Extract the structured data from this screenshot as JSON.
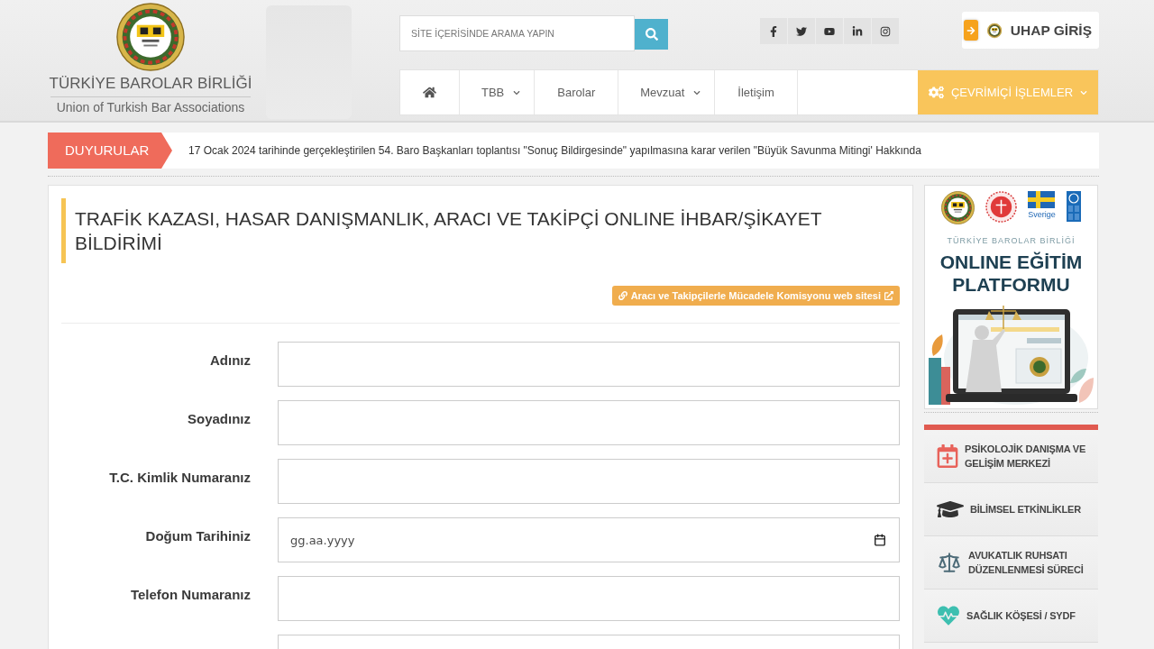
{
  "header": {
    "logo": {
      "title": "TÜRKİYE BAROLAR BİRLİĞİ",
      "subtitle": "Union of Turkish Bar Associations"
    },
    "search": {
      "placeholder": "SİTE İÇERİSİNDE ARAMA YAPIN"
    },
    "social": [
      {
        "kind": "facebook"
      },
      {
        "kind": "twitter"
      },
      {
        "kind": "youtube"
      },
      {
        "kind": "linkedin"
      },
      {
        "kind": "instagram"
      }
    ],
    "login_button": {
      "label": "UHAP GİRİŞ"
    }
  },
  "nav": {
    "items": [
      {
        "kind": "home"
      },
      {
        "kind": "link",
        "label": "TBB",
        "dropdown": true
      },
      {
        "kind": "link",
        "label": "Barolar",
        "dropdown": false
      },
      {
        "kind": "link",
        "label": "Mevzuat",
        "dropdown": true
      },
      {
        "kind": "link",
        "label": "İletişim",
        "dropdown": false
      }
    ],
    "online_button": {
      "label": "ÇEVRİMİÇİ İŞLEMLER",
      "dropdown": true
    }
  },
  "announcements": {
    "label": "DUYURULAR",
    "text": "17 Ocak 2024 tarihinde gerçekleştirilen 54. Baro Başkanları toplantısı \"Sonuç Bildirgesinde\" yapılmasına karar verilen \"Büyük Savunma Mitingi' Hakkında"
  },
  "form": {
    "title": "TRAFİK KAZASI, HASAR DANIŞMANLIK, ARACI VE TAKİPÇİ ONLINE İHBAR/ŞİKAYET BİLDİRİMİ",
    "link_button": {
      "label": "Aracı ve Takipçilerle Mücadele Komisyonu web sitesi"
    },
    "fields": [
      {
        "kind": "text",
        "label": "Adınız"
      },
      {
        "kind": "text",
        "label": "Soyadınız"
      },
      {
        "kind": "text",
        "label": "T.C. Kimlik Numaranız"
      },
      {
        "kind": "date",
        "label": "Doğum Tarihiniz",
        "placeholder": "gg.aa.yyyy"
      },
      {
        "kind": "text",
        "label": "Telefon Numaranız"
      },
      {
        "kind": "text"
      }
    ]
  },
  "sidebar": {
    "banner": {
      "logos": [
        {
          "kind": "tbb"
        },
        {
          "kind": "judiciary"
        },
        {
          "kind": "sweden",
          "caption": "Sverige"
        },
        {
          "kind": "undp"
        }
      ],
      "top_label": "TÜRKİYE BAROLAR BİRLİĞİ",
      "title": "ONLINE EĞİTİM PLATFORMU"
    },
    "menu": [
      {
        "kind": "calendar",
        "label": "PSİKOLOJİK DANIŞMA VE GELİŞİM MERKEZİ"
      },
      {
        "kind": "graduation",
        "label": "BİLİMSEL ETKİNLİKLER"
      },
      {
        "kind": "scale",
        "label": "AVUKATLIK RUHSATI DÜZENLENMESİ SÜRECİ"
      },
      {
        "kind": "health",
        "label": "SAĞLIK KÖŞESİ / SYDF"
      }
    ]
  }
}
